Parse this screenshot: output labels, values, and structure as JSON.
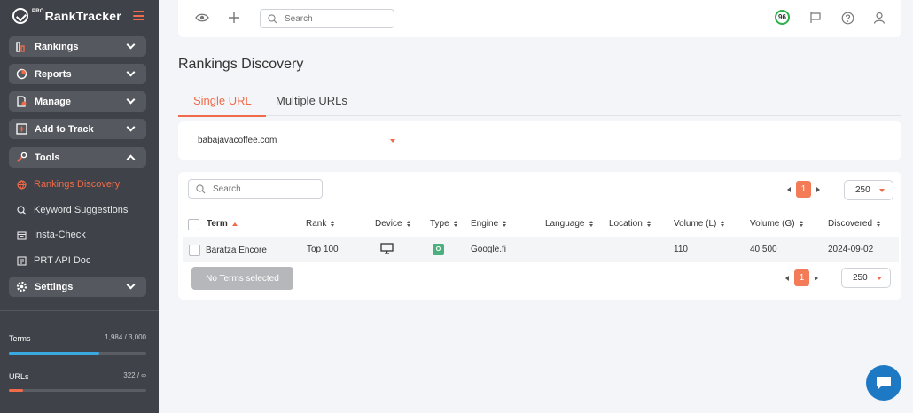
{
  "brand": {
    "name": "RankTracker",
    "prefix": "PRO"
  },
  "sidebar": {
    "nav": [
      {
        "label": "Rankings",
        "icon": "bar-chart-icon"
      },
      {
        "label": "Reports",
        "icon": "pie-chart-icon"
      },
      {
        "label": "Manage",
        "icon": "document-settings-icon"
      },
      {
        "label": "Add to Track",
        "icon": "plus-square-icon"
      },
      {
        "label": "Tools",
        "icon": "tools-icon"
      }
    ],
    "tools_items": [
      {
        "label": "Rankings Discovery",
        "icon": "globe-icon",
        "active": true
      },
      {
        "label": "Keyword Suggestions",
        "icon": "search-icon",
        "active": false
      },
      {
        "label": "Insta-Check",
        "icon": "calendar-icon",
        "active": false
      },
      {
        "label": "PRT API Doc",
        "icon": "api-doc-icon",
        "active": false
      }
    ],
    "settings": {
      "label": "Settings",
      "icon": "gear-icon"
    },
    "usage": {
      "terms": {
        "label": "Terms",
        "value": "1,984 / 3,000",
        "fraction": 0.661
      },
      "urls": {
        "label": "URLs",
        "value": "322 / ∞",
        "fraction": 0.1
      }
    }
  },
  "topbar": {
    "search_placeholder": "Search",
    "score": "96"
  },
  "page": {
    "title": "Rankings Discovery",
    "tabs": [
      {
        "label": "Single URL",
        "active": true
      },
      {
        "label": "Multiple URLs",
        "active": false
      }
    ],
    "selected_url": "babajavacoffee.com"
  },
  "results": {
    "search_placeholder": "Search",
    "page": "1",
    "page_size": "250",
    "columns": [
      "Term",
      "Rank",
      "Device",
      "Type",
      "Engine",
      "Language",
      "Location",
      "Volume (L)",
      "Volume (G)",
      "Discovered"
    ],
    "rows": [
      {
        "term": "Baratza Encore",
        "rank": "Top 100",
        "device": "desktop-icon",
        "type": "O",
        "engine": "Google.fi",
        "language": "",
        "location": "",
        "volume_l": "110",
        "volume_g": "40,500",
        "discovered": "2024-09-02"
      }
    ],
    "no_terms_label": "No Terms selected"
  },
  "colors": {
    "accent": "#f06b4a",
    "sidebar_bg": "#3f4248",
    "terms_bar": "#3aa9e0",
    "urls_bar": "#f06b4a",
    "score_ring": "#2db14a",
    "chat": "#1e79c4"
  }
}
